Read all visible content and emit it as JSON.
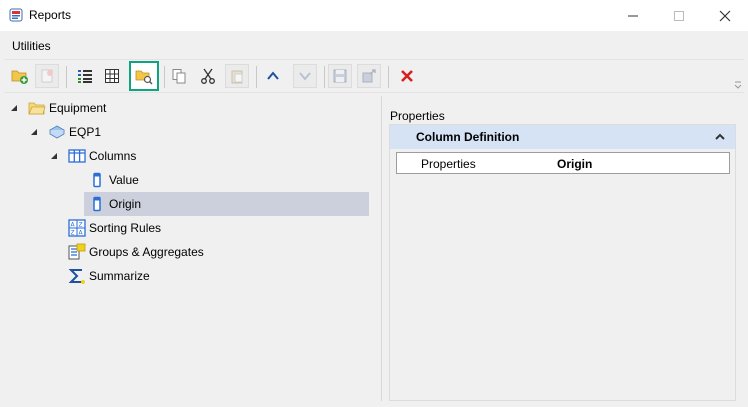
{
  "window": {
    "title": "Reports",
    "minimize_label": "—",
    "maximize_label": "☐",
    "close_label": "✕"
  },
  "menu": {
    "items": [
      "Utilities"
    ]
  },
  "toolbar": {
    "buttons": [
      {
        "icon": "add-folder-icon",
        "enabled": true
      },
      {
        "icon": "report-icon",
        "enabled": false
      },
      {
        "icon": "list-view-icon",
        "enabled": true
      },
      {
        "icon": "grid-icon",
        "enabled": true
      },
      {
        "icon": "folder-search-icon",
        "enabled": true,
        "selected": true
      },
      {
        "icon": "copy-icon",
        "enabled": true
      },
      {
        "icon": "cut-icon",
        "enabled": true
      },
      {
        "icon": "paste-icon",
        "enabled": false
      },
      {
        "icon": "move-up-icon",
        "enabled": true
      },
      {
        "icon": "move-down-icon",
        "enabled": false
      },
      {
        "icon": "save-icon",
        "enabled": false
      },
      {
        "icon": "export-icon",
        "enabled": false
      },
      {
        "icon": "delete-icon",
        "enabled": true
      }
    ]
  },
  "tree": {
    "nodes": [
      {
        "label": "Equipment",
        "icon": "folder-icon",
        "expanded": true
      },
      {
        "label": "EQP1",
        "icon": "database-icon",
        "expanded": true
      },
      {
        "label": "Columns",
        "icon": "columns-icon",
        "expanded": true
      },
      {
        "label": "Value",
        "icon": "column-icon"
      },
      {
        "label": "Origin",
        "icon": "column-icon",
        "selected": true
      },
      {
        "label": "Sorting Rules",
        "icon": "sort-icon"
      },
      {
        "label": "Groups & Aggregates",
        "icon": "group-icon"
      },
      {
        "label": "Summarize",
        "icon": "sigma-icon"
      }
    ]
  },
  "properties": {
    "title": "Properties",
    "section": "Column Definition",
    "rows": [
      {
        "key": "Properties",
        "value": "Origin"
      }
    ]
  },
  "colors": {
    "accent": "#10a37f",
    "selection": "#ccd0dc",
    "header": "#d5e3f5"
  }
}
